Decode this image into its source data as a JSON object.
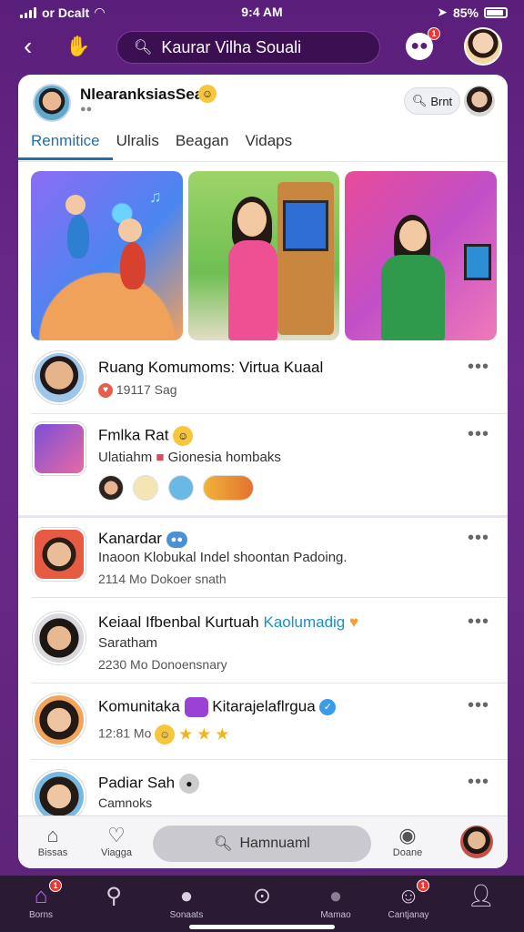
{
  "status": {
    "carrier": "or Dcalt",
    "time": "9:4 AM",
    "battery": "85%"
  },
  "top_nav": {
    "search_text": "Kaurar Vilha Souali",
    "chat_badge": "1"
  },
  "community": {
    "name": "NlearanksiasSear",
    "sub": "●●",
    "search_label": "Brnt",
    "tabs": [
      "Renmitice",
      "Ulralis",
      "Beagan",
      "Vidaps"
    ]
  },
  "rows": [
    {
      "title": "Ruang Komumoms: Virtua Kuaal",
      "meta": "19117 Sag"
    },
    {
      "title": "Fmlka Rat",
      "sub": "Ulatiahm",
      "sub2": "Gionesia hombaks"
    },
    {
      "title": "Kanardar",
      "sub": "Inaoon Klobukal Indel shoontan Padoing.",
      "meta": "2114 Mo Dokoer snath"
    },
    {
      "title_a": "Keiaal Ifbenbal Kurtuah",
      "title_b": "Kaolumadig",
      "sub": "Saratham",
      "meta": "2230 Mo Donoensnary"
    },
    {
      "title_a": "Komunitaka",
      "title_b": "Kitarajelaflrgua",
      "meta": "12:81 Mo"
    },
    {
      "title": "Padiar Sah",
      "sub": "Camnoks"
    }
  ],
  "inner_bar": {
    "left_label": "Bissas",
    "second_label": "Viagga",
    "search_text": "Hamnuaml",
    "right_label": "Doane"
  },
  "tab_bar": {
    "items": [
      {
        "label": "Borns",
        "badge": "1"
      },
      {
        "label": ""
      },
      {
        "label": "Sonaats"
      },
      {
        "label": ""
      },
      {
        "label": "Mamao"
      },
      {
        "label": "Cantjanay",
        "badge": "1"
      },
      {
        "label": ""
      }
    ]
  }
}
